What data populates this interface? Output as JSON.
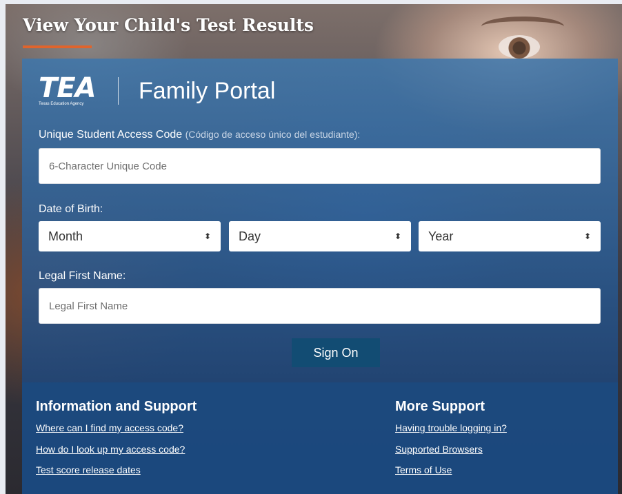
{
  "page": {
    "title": "View Your Child's Test Results"
  },
  "brand": {
    "logo_text": "TEA",
    "logo_subtitle": "Texas Education Agency",
    "portal_name": "Family Portal"
  },
  "form": {
    "access_code": {
      "label": "Unique Student Access Code",
      "label_spanish": "(Código de acceso único del estudiante):",
      "placeholder": "6-Character Unique Code"
    },
    "dob": {
      "label": "Date of Birth:",
      "month": "Month",
      "day": "Day",
      "year": "Year"
    },
    "first_name": {
      "label": "Legal First Name:",
      "placeholder": "Legal First Name"
    },
    "submit_label": "Sign On"
  },
  "support": {
    "info": {
      "heading": "Information and Support",
      "links": [
        "Where can I find my access code?",
        "How do I look up my access code?",
        "Test score release dates"
      ]
    },
    "more": {
      "heading": "More Support",
      "links": [
        "Having trouble logging in?",
        "Supported Browsers",
        "Terms of Use"
      ]
    }
  },
  "colors": {
    "accent": "#e0642c",
    "button": "#124c73",
    "support_bg": "#1b4a80"
  }
}
